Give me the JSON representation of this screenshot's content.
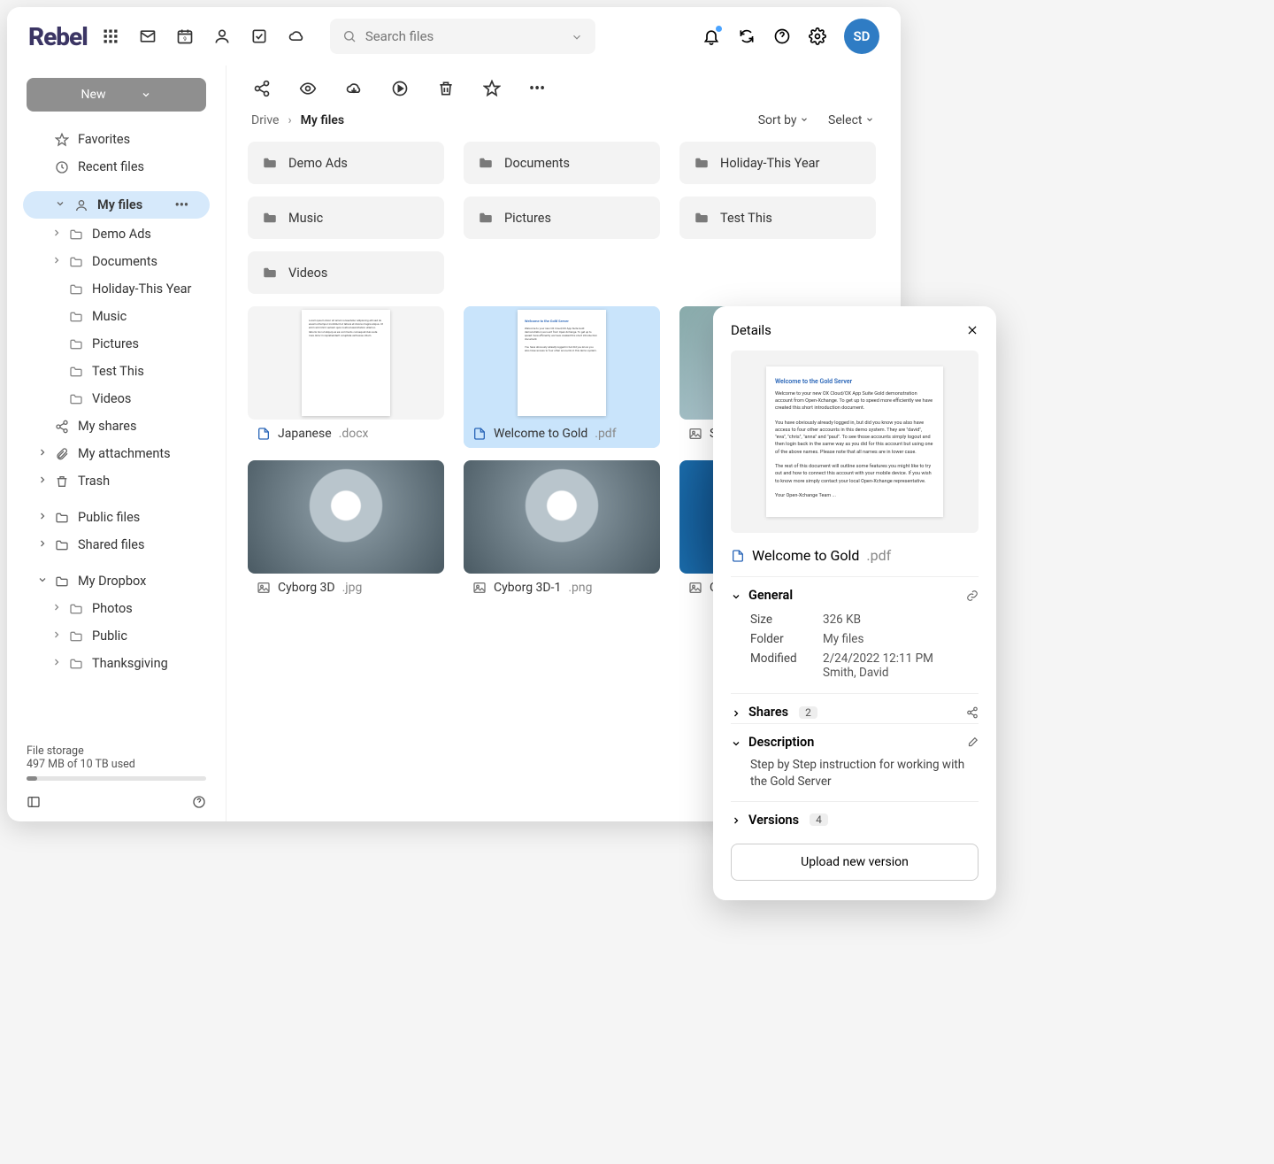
{
  "brand": "Rebel",
  "search": {
    "placeholder": "Search files"
  },
  "avatar": "SD",
  "newButton": "New",
  "sidebar": {
    "favorites": "Favorites",
    "recent": "Recent files",
    "myfiles": "My files",
    "tree": [
      "Demo Ads",
      "Documents",
      "Holiday-This Year",
      "Music",
      "Pictures",
      "Test This",
      "Videos"
    ],
    "myshares": "My shares",
    "myattachments": "My attachments",
    "trash": "Trash",
    "publicfiles": "Public files",
    "sharedfiles": "Shared files",
    "mydropbox": "My Dropbox",
    "dropbox": [
      "Photos",
      "Public",
      "Thanksgiving"
    ]
  },
  "storage": {
    "label": "File storage",
    "used": "497 MB of 10 TB used"
  },
  "breadcrumb": {
    "root": "Drive",
    "current": "My files"
  },
  "sortby": "Sort by",
  "select": "Select",
  "folders": [
    "Demo Ads",
    "Documents",
    "Holiday-This Year",
    "Music",
    "Pictures",
    "Test This",
    "Videos"
  ],
  "files": [
    {
      "name": "Japanese",
      "ext": ".docx",
      "type": "doc"
    },
    {
      "name": "Welcome to Gold",
      "ext": ".pdf",
      "type": "pdf",
      "selected": true
    },
    {
      "name": "Sushi",
      "ext": "",
      "type": "img"
    },
    {
      "name": "Cyborg 3D",
      "ext": ".jpg",
      "type": "robot"
    },
    {
      "name": "Cyborg 3D-1",
      "ext": ".png",
      "type": "robot"
    },
    {
      "name": "Ocean",
      "ext": "",
      "type": "ocean"
    }
  ],
  "details": {
    "title": "Details",
    "preview": {
      "heading": "Welcome to the Gold Server",
      "p1": "Welcome to your new OX Cloud/OX App Suite Gold demonstration account from Open-Xchange. To get up to speed more efficiently we have created this short introduction document.",
      "p2": "You have obviously already logged in, but did you know you also have access to four other accounts in this demo system. They are \"david\", \"eva\", \"chris\", \"anna\" and \"paul\". To see those accounts simply logout and then login back in the same way as you did for this account but using one of the above names. Please note that all names are in lower case.",
      "p3": "The rest of this document will outline some features you might like to try out and how to connect this account with your mobile device. If you wish to know more simply contact your local Open-Xchange representative.",
      "p4": "Your Open-Xchange Team ..."
    },
    "file": {
      "name": "Welcome to Gold",
      "ext": ".pdf"
    },
    "general": {
      "label": "General",
      "size_k": "Size",
      "size_v": "326 KB",
      "folder_k": "Folder",
      "folder_v": "My files",
      "modified_k": "Modified",
      "modified_v1": "2/24/2022 12:11 PM",
      "modified_v2": "Smith, David"
    },
    "shares": {
      "label": "Shares",
      "count": "2"
    },
    "description": {
      "label": "Description",
      "text": "Step by Step instruction for working with the Gold Server"
    },
    "versions": {
      "label": "Versions",
      "count": "4"
    },
    "upload": "Upload new version"
  }
}
